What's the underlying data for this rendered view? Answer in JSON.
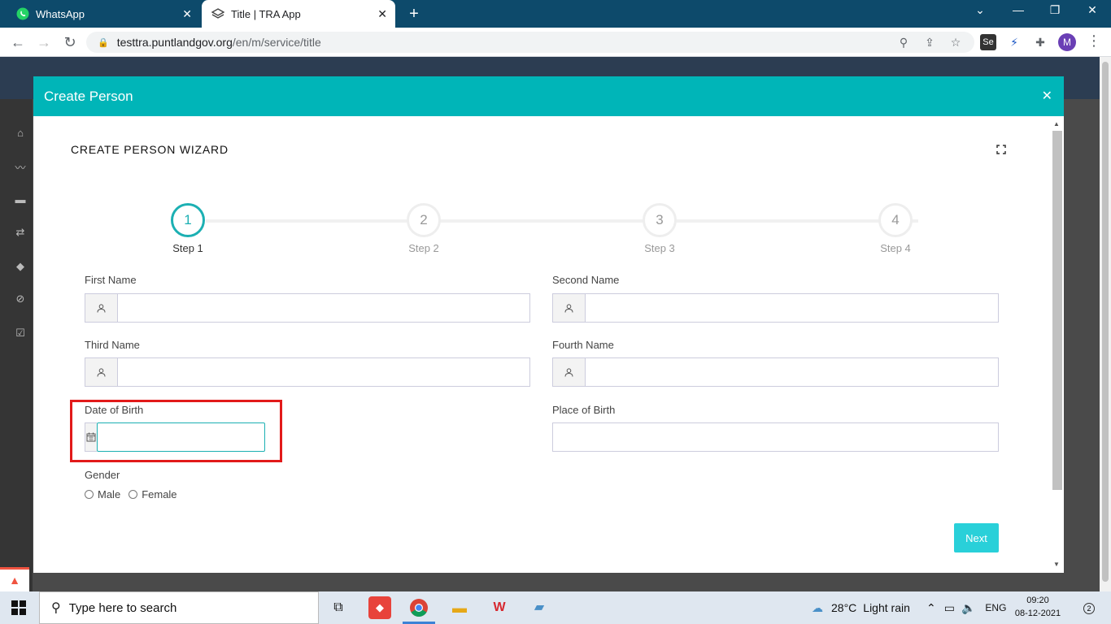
{
  "browser": {
    "tabs": [
      {
        "label": "WhatsApp",
        "active": false
      },
      {
        "label": "Title | TRA App",
        "active": true
      }
    ],
    "url_host": "testtra.puntlandgov.org",
    "url_path": "/en/m/service/title",
    "profile_initial": "M",
    "ext_selenium": "Se"
  },
  "modal": {
    "title": "Create Person",
    "wizard_title": "CREATE PERSON WIZARD",
    "steps": [
      {
        "number": "1",
        "label": "Step 1"
      },
      {
        "number": "2",
        "label": "Step 2"
      },
      {
        "number": "3",
        "label": "Step 3"
      },
      {
        "number": "4",
        "label": "Step 4"
      }
    ],
    "current_step": 1,
    "fields": {
      "first_name": {
        "label": "First Name",
        "value": ""
      },
      "second_name": {
        "label": "Second Name",
        "value": ""
      },
      "third_name": {
        "label": "Third Name",
        "value": ""
      },
      "fourth_name": {
        "label": "Fourth Name",
        "value": ""
      },
      "date_of_birth": {
        "label": "Date of Birth",
        "value": ""
      },
      "place_of_birth": {
        "label": "Place of Birth",
        "value": ""
      }
    },
    "gender": {
      "label": "Gender",
      "options": [
        "Male",
        "Female"
      ]
    },
    "next_label": "Next"
  },
  "taskbar": {
    "search_placeholder": "Type here to search",
    "weather_temp": "28°C",
    "weather_desc": "Light rain",
    "language": "ENG",
    "time": "09:20",
    "date": "08-12-2021",
    "notification_count": "2"
  },
  "colors": {
    "modal_header": "#00b5b8",
    "active_step": "#1cb0b3",
    "next_button": "#29d0d9",
    "highlight": "#e21a1a"
  }
}
